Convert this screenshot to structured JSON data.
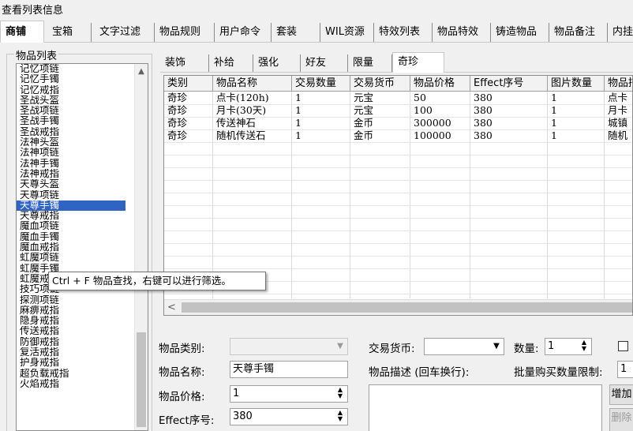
{
  "window": {
    "title": "查看列表信息"
  },
  "main_tabs": [
    "商铺",
    "宝箱",
    "文字过滤",
    "物品规则",
    "用户命令",
    "套装",
    "WIL资源",
    "特效列表",
    "物品特效",
    "铸造物品",
    "物品备注",
    "内挂"
  ],
  "item_list": {
    "group_label": "物品列表",
    "items": [
      "记忆项链",
      "记忆手镯",
      "记忆戒指",
      "圣战头盔",
      "圣战项链",
      "圣战手镯",
      "圣战戒指",
      "法神头盔",
      "法神项链",
      "法神手镯",
      "法神戒指",
      "天尊头盔",
      "天尊项链",
      "天尊手镯",
      "天尊戒指",
      "魔血项链",
      "魔血手镯",
      "魔血戒指",
      "虹魔项链",
      "虹魔手镯",
      "虹魔戒指",
      "技巧项链",
      "探测项链",
      "麻痹戒指",
      "隐身戒指",
      "传送戒指",
      "防御戒指",
      "复活戒指",
      "护身戒指",
      "超负载戒指",
      "火焰戒指"
    ],
    "selected": "天尊手镯"
  },
  "tooltip": "Ctrl + F 物品查找，右键可以进行筛选。",
  "sub_tabs": [
    "装饰",
    "补给",
    "强化",
    "好友",
    "限量",
    "奇珍"
  ],
  "active_sub_tab": "奇珍",
  "grid": {
    "columns": [
      "类别",
      "物品名称",
      "交易数量",
      "交易货币",
      "物品价格",
      "Effect序号",
      "图片数量",
      "物品描述"
    ],
    "rows": [
      [
        "奇珍",
        "点卡(120h)",
        "1",
        "元宝",
        "50",
        "380",
        "1",
        "点卡"
      ],
      [
        "奇珍",
        "月卡(30天)",
        "1",
        "元宝",
        "100",
        "380",
        "1",
        "月卡"
      ],
      [
        "奇珍",
        "传送神石",
        "1",
        "金币",
        "300000",
        "380",
        "1",
        "城镇"
      ],
      [
        "奇珍",
        "随机传送石",
        "1",
        "金币",
        "100000",
        "380",
        "1",
        "随机"
      ]
    ]
  },
  "form": {
    "category_label": "物品类别:",
    "category_value": "",
    "name_label": "物品名称:",
    "name_value": "天尊手镯",
    "price_label": "物品价格:",
    "price_value": "1",
    "effect_label": "Effect序号:",
    "effect_value": "380",
    "currency_label": "交易货币:",
    "currency_value": "",
    "qty_label": "数量:",
    "qty_value": "1",
    "desc_label": "物品描述 (回车换行):",
    "desc_value": "",
    "bulk_label": "批量购买数量限制:",
    "bulk_value": "1",
    "add_button": "增加",
    "delete_button": "删除"
  }
}
